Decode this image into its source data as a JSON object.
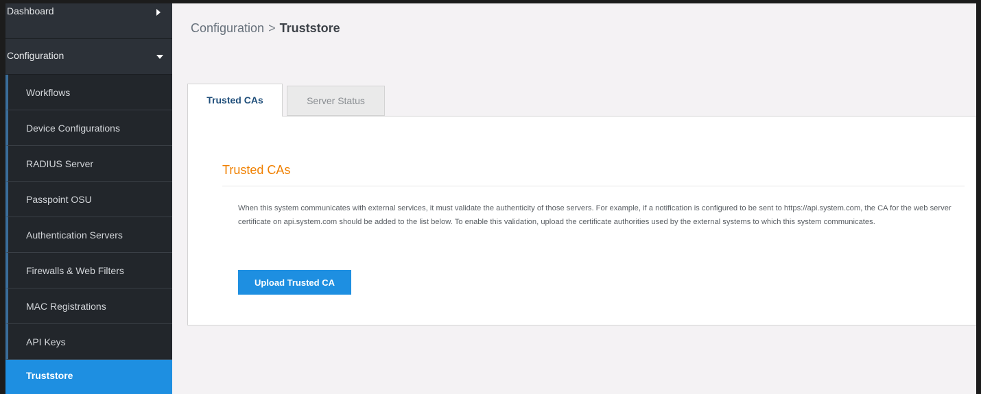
{
  "sidebar": {
    "dashboard_label": "Dashboard",
    "configuration_label": "Configuration",
    "items": [
      {
        "label": "Workflows"
      },
      {
        "label": "Device Configurations"
      },
      {
        "label": "RADIUS Server"
      },
      {
        "label": "Passpoint OSU"
      },
      {
        "label": "Authentication Servers"
      },
      {
        "label": "Firewalls & Web Filters"
      },
      {
        "label": "MAC Registrations"
      },
      {
        "label": "API Keys"
      },
      {
        "label": "Truststore",
        "active": true
      }
    ]
  },
  "breadcrumb": {
    "parent": "Configuration",
    "separator": ">",
    "current": "Truststore"
  },
  "tabs": [
    {
      "label": "Trusted CAs",
      "active": true
    },
    {
      "label": "Server Status",
      "active": false
    }
  ],
  "section": {
    "title": "Trusted CAs",
    "description": "When this system communicates with external services, it must validate the authenticity of those servers. For example, if a notification is configured to be sent to https://api.system.com, the CA for the web server certificate on api.system.com should be added to the list below. To enable this validation, upload the certificate authorities used by the external systems to which this system communicates.",
    "upload_button": "Upload Trusted CA"
  },
  "colors": {
    "sidebar_bg": "#2c3138",
    "active_item": "#1e8fe1",
    "section_title": "#f08000",
    "button": "#1e8fe1"
  },
  "icons": {
    "dashboard_caret": "caret-right-icon",
    "configuration_caret": "caret-down-icon"
  }
}
